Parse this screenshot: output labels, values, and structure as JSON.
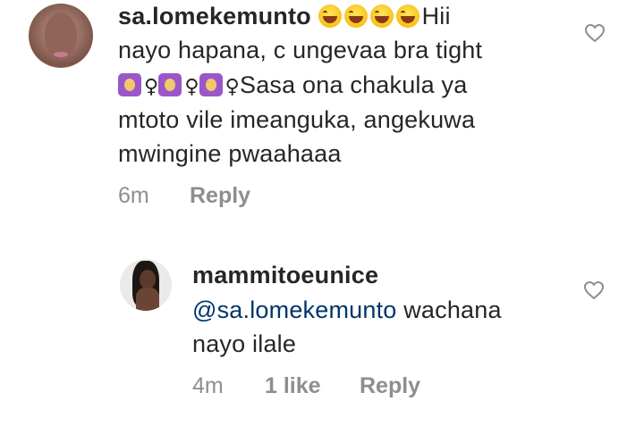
{
  "comments": [
    {
      "username": "sa.lomekemunto",
      "line1_tail": "Hii",
      "line2": "nayo hapana, c ungevaa bra tight",
      "line3_tail": "Sasa ona chakula ya",
      "line4": "mtoto vile imeanguka, angekuwa",
      "line5": "mwingine pwaahaaa",
      "time": "6m",
      "reply_label": "Reply",
      "emoji_icons": [
        "grinning-sweat-emoji",
        "grinning-sweat-emoji",
        "grinning-sweat-emoji",
        "grinning-sweat-emoji"
      ],
      "gesture_icons": [
        "woman-gesturing-emoji",
        "woman-gesturing-emoji",
        "woman-gesturing-emoji"
      ],
      "female_sign": "♀"
    }
  ],
  "reply": {
    "username": "mammitoeunice",
    "mention": "@sa.lomekemunto",
    "line1_tail": " wachana",
    "line2": "nayo ilale",
    "time": "4m",
    "likes": "1 like",
    "reply_label": "Reply"
  },
  "colors": {
    "text": "#262626",
    "meta": "#8e8e8e",
    "mention": "#003569"
  }
}
